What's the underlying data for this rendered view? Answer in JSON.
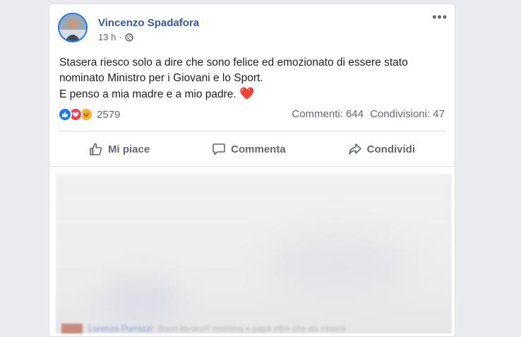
{
  "post": {
    "author": "Vincenzo Spadafora",
    "time": "13 h",
    "separator": "·",
    "text_lines": [
      "Stasera riesco solo a dire che sono felice ed emozionato di essere stato",
      "nominato Ministro per i Giovani e lo Sport.",
      "E penso a mia madre e a mio padre."
    ],
    "emoji": "❤️",
    "more_icon": "•••"
  },
  "reactions": {
    "count": "2579",
    "types": [
      "like",
      "love",
      "haha"
    ]
  },
  "stats": {
    "comments": "Commenti: 644",
    "shares": "Condivisioni: 47"
  },
  "actions": {
    "like": "Mi piace",
    "comment": "Commenta",
    "share": "Condividi"
  },
  "preview": {
    "footer_name": "Lorenza Porrazzi",
    "footer_text": "Buon lavoro!!! mamma e papà oltre che da essere"
  },
  "colors": {
    "accent": "#1877f2",
    "author": "#385898",
    "love": "#f33e58",
    "haha": "#f7b125"
  }
}
